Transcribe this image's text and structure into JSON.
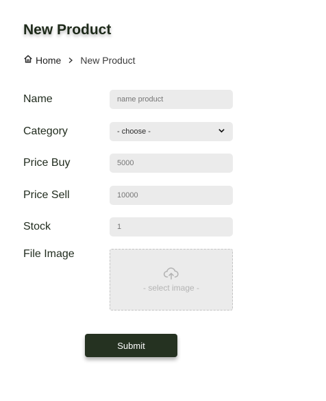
{
  "page": {
    "title": "New Product"
  },
  "breadcrumb": {
    "home": "Home",
    "current": "New Product"
  },
  "form": {
    "name": {
      "label": "Name",
      "placeholder": "name product",
      "value": ""
    },
    "category": {
      "label": "Category",
      "selected": "- choose -"
    },
    "price_buy": {
      "label": "Price Buy",
      "placeholder": "5000",
      "value": ""
    },
    "price_sell": {
      "label": "Price Sell",
      "placeholder": "10000",
      "value": ""
    },
    "stock": {
      "label": "Stock",
      "placeholder": "1",
      "value": ""
    },
    "file_image": {
      "label": "File Image",
      "dropzone_text": "- select image -"
    },
    "submit_label": "Submit"
  },
  "colors": {
    "primary": "#253221",
    "field_bg": "#ebebeb"
  },
  "icons": {
    "home": "home-icon",
    "separator": "chevron-right-icon",
    "select": "chevron-down-icon",
    "upload": "cloud-upload-icon"
  }
}
